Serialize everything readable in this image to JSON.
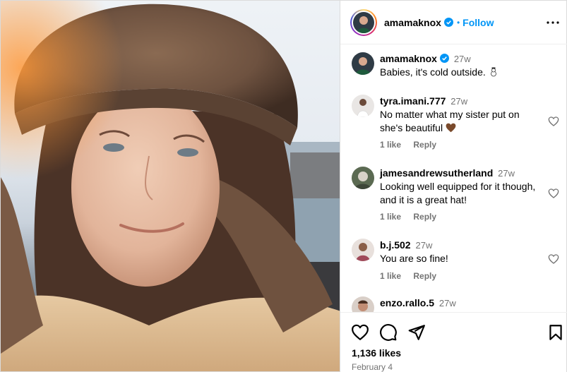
{
  "post": {
    "username": "amamaknox",
    "follow_label": "Follow",
    "separator": "•"
  },
  "caption": {
    "username": "amamaknox",
    "time": "27w",
    "text": "Babies, it's cold outside."
  },
  "comments": [
    {
      "username": "tyra.imani.777",
      "time": "27w",
      "text": "No matter what my sister put on she's beautiful",
      "likes": "1 like",
      "reply": "Reply"
    },
    {
      "username": "jamesandrewsutherland",
      "time": "27w",
      "text": "Looking well equipped for it though, and it is a great hat!",
      "likes": "1 like",
      "reply": "Reply"
    },
    {
      "username": "b.j.502",
      "time": "27w",
      "text": "You are so fine!",
      "likes": "1 like",
      "reply": "Reply"
    },
    {
      "username": "enzo.rallo.5",
      "time": "27w",
      "text": ""
    }
  ],
  "footer": {
    "likes": "1,136 likes",
    "date": "February 4"
  },
  "icons": {
    "more": "more-horizontal-icon",
    "like": "heart-icon",
    "comment": "comment-bubble-icon",
    "share": "paper-plane-icon",
    "save": "bookmark-icon",
    "verified": "verified-badge-icon"
  },
  "colors": {
    "accent": "#0095f6",
    "muted": "#737373",
    "border": "#dbdbdb"
  }
}
